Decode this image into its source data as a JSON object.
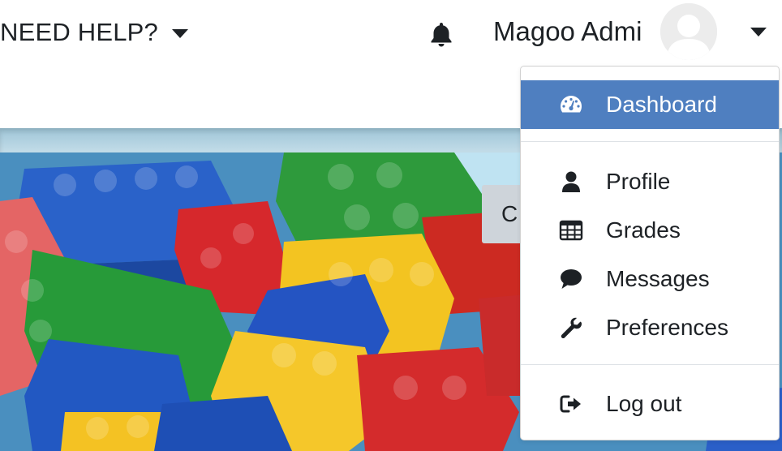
{
  "navbar": {
    "help_label": "NEED HELP?",
    "user_name": "Magoo Admi"
  },
  "hero": {
    "button_partial_label": "C"
  },
  "user_menu": {
    "items": [
      {
        "label": "Dashboard",
        "icon": "dashboard-icon",
        "active": true
      },
      {
        "label": "Profile",
        "icon": "user-icon"
      },
      {
        "label": "Grades",
        "icon": "table-icon"
      },
      {
        "label": "Messages",
        "icon": "comment-icon"
      },
      {
        "label": "Preferences",
        "icon": "wrench-icon"
      },
      {
        "label": "Log out",
        "icon": "sign-out-icon"
      }
    ]
  },
  "colors": {
    "active_item_bg": "#4f7fc0",
    "text": "#1d2125",
    "navbar_bg": "#ffffff"
  }
}
